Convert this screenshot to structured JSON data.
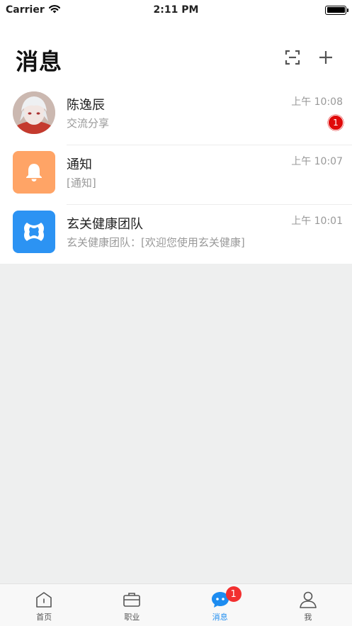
{
  "status_bar": {
    "carrier": "Carrier",
    "time": "2:11 PM"
  },
  "header": {
    "title": "消息"
  },
  "icons": {
    "wifi": "wifi-icon",
    "battery": "battery-icon",
    "scan": "scan-icon",
    "add": "plus-icon",
    "bell": "bell-icon",
    "team_logo": "xuanguan-logo-icon",
    "home": "home-icon",
    "career": "briefcase-icon",
    "messages": "chat-bubble-icon",
    "profile": "person-icon"
  },
  "colors": {
    "accent": "#1d8cf0",
    "badge": "#e00a0a",
    "notify_bg": "#ffa466",
    "team_bg": "#2c93f3"
  },
  "conversations": [
    {
      "name": "陈逸辰",
      "preview": "交流分享",
      "time": "上午 10:08",
      "unread": "1"
    },
    {
      "name": "通知",
      "preview": "[通知]",
      "time": "上午 10:07"
    },
    {
      "name": "玄关健康团队",
      "preview": "玄关健康团队：[欢迎您使用玄关健康]",
      "time": "上午 10:01"
    }
  ],
  "tabbar": {
    "items": [
      {
        "label": "首页"
      },
      {
        "label": "职业"
      },
      {
        "label": "消息",
        "badge": "1",
        "active": true
      },
      {
        "label": "我"
      }
    ]
  }
}
